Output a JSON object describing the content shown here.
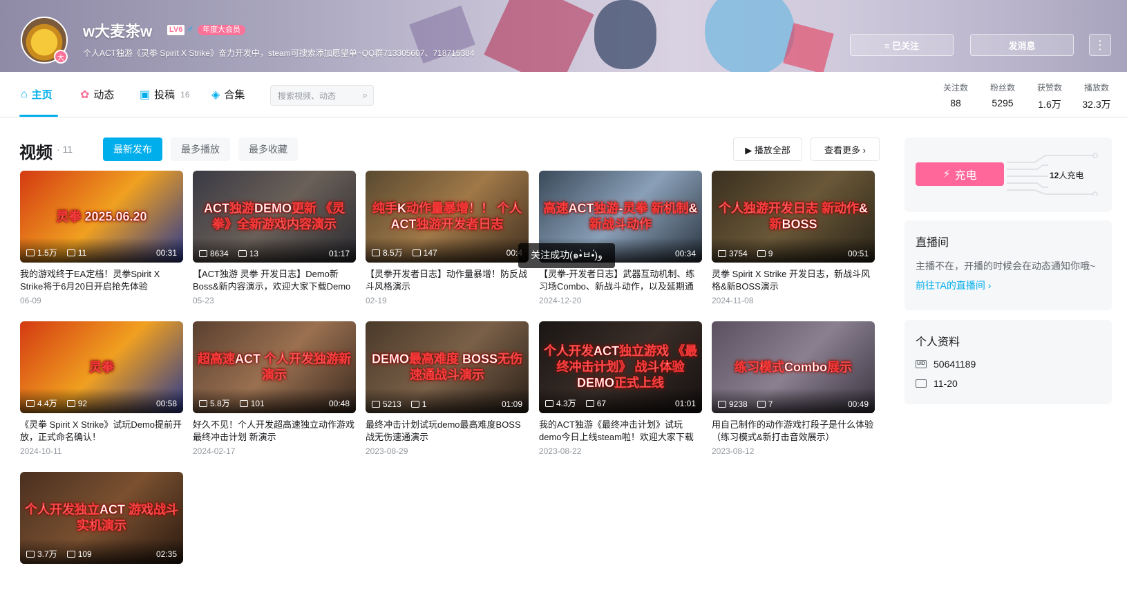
{
  "header": {
    "username": "w大麦茶w",
    "level": "LV6",
    "gender_symbol": "♂",
    "vip_badge": "年度大会员",
    "avatar_badge": "大",
    "signature": "个人ACT独游《灵拳 Spirit X Strike》奋力开发中，steam可搜索添加愿望单~QQ群713305607、718715384",
    "follow_button": "≡ 已关注",
    "message_button": "发消息",
    "more_button": "⋮"
  },
  "nav": {
    "items": [
      {
        "label": "主页",
        "icon": "home-icon"
      },
      {
        "label": "动态",
        "icon": "pinwheel-icon"
      },
      {
        "label": "投稿",
        "icon": "tv-icon",
        "count": "16"
      },
      {
        "label": "合集",
        "icon": "layers-icon"
      }
    ],
    "search_placeholder": "搜索视频、动态",
    "stats": [
      {
        "label": "关注数",
        "value": "88"
      },
      {
        "label": "粉丝数",
        "value": "5295"
      },
      {
        "label": "获赞数",
        "value": "1.6万"
      },
      {
        "label": "播放数",
        "value": "32.3万"
      }
    ]
  },
  "videos_section": {
    "title": "视频",
    "count": "· 11",
    "tabs": [
      "最新发布",
      "最多播放",
      "最多收藏"
    ],
    "play_all": "▶ 播放全部",
    "view_more": "查看更多 ›"
  },
  "videos": [
    {
      "thumb_text": "灵拳 2025.06.20",
      "views": "1.5万",
      "danmaku": "11",
      "duration": "00:31",
      "title": "我的游戏终于EA定档！灵拳Spirit X Strike将于6月20日开启抢先体验",
      "date": "06-09",
      "bg": "linear-gradient(135deg,#d43a12,#f0a020 50%,#2a3a90)"
    },
    {
      "thumb_text": "ACT独游DEMO更新 《灵拳》全新游戏内容演示",
      "views": "8634",
      "danmaku": "13",
      "duration": "01:17",
      "title": "【ACT独游 灵拳 开发日志】Demo新Boss&新内容演示，欢迎大家下载Demo体…",
      "date": "05-23",
      "bg": "linear-gradient(135deg,#3a3a44,#6a6058 50%,#2a2a30)"
    },
    {
      "thumb_text": "纯手K动作量暴增！！ 个人ACT独游开发者日志",
      "views": "8.5万",
      "danmaku": "147",
      "duration": "00:4",
      "title": "【灵拳开发者日志】动作量暴增！防反战斗风格演示",
      "date": "02-19",
      "bg": "linear-gradient(135deg,#5a4a30,#a07848 50%,#403020)"
    },
    {
      "thumb_text": "高速ACT独游-灵拳 新机制&新战斗动作",
      "views": "",
      "danmaku": "",
      "duration": "00:34",
      "title": "【灵拳-开发者日志】武器互动机制、练习场Combo、新战斗动作，以及延期通知",
      "date": "2024-12-20",
      "bg": "linear-gradient(135deg,#3a4a5a,#8aa0b8 50%,#2a3440)"
    },
    {
      "thumb_text": "个人独游开发日志 新动作&新BOSS",
      "views": "3754",
      "danmaku": "9",
      "duration": "00:51",
      "title": "灵拳 Spirit X Strike 开发日志，新战斗风格&新BOSS演示",
      "date": "2024-11-08",
      "bg": "linear-gradient(135deg,#3a3020,#6a5838 50%,#2a2418)"
    },
    {
      "thumb_text": "灵拳",
      "views": "4.4万",
      "danmaku": "92",
      "duration": "00:58",
      "title": "《灵拳 Spirit X Strike》试玩Demo提前开放，正式命名确认！",
      "date": "2024-10-11",
      "bg": "linear-gradient(135deg,#d43a12,#f0a020 50%,#2a3a90)"
    },
    {
      "thumb_text": "超高速ACT 个人开发独游新演示",
      "views": "5.8万",
      "danmaku": "101",
      "duration": "00:48",
      "title": "好久不见！个人开发超高速独立动作游戏最终冲击计划 新演示",
      "date": "2024-02-17",
      "bg": "linear-gradient(135deg,#5a4030,#9a7050 50%,#3a2a20)"
    },
    {
      "thumb_text": "DEMO最高难度 BOSS无伤速通战斗演示",
      "views": "5213",
      "danmaku": "1",
      "duration": "01:09",
      "title": "最终冲击计划试玩demo最高难度BOSS战无伤速通演示",
      "date": "2023-08-29",
      "bg": "linear-gradient(135deg,#4a3a2a,#7a6048 50%,#2a2018)"
    },
    {
      "thumb_text": "个人开发ACT独立游戏 《最终冲击计划》 战斗体验DEMO正式上线",
      "views": "4.3万",
      "danmaku": "67",
      "duration": "01:01",
      "title": "我的ACT独游《最终冲击计划》试玩demo今日上线steam啦！欢迎大家下载体验",
      "date": "2023-08-22",
      "bg": "linear-gradient(135deg,#1a1614,#3a2e28 50%,#141010)"
    },
    {
      "thumb_text": "练习模式Combo展示",
      "views": "9238",
      "danmaku": "7",
      "duration": "00:49",
      "title": "用自己制作的动作游戏打段子是什么体验（练习模式&新打击音效展示）",
      "date": "2023-08-12",
      "bg": "linear-gradient(135deg,#5a5060,#8a8090 50%,#3a3440)"
    },
    {
      "thumb_text": "个人开发独立ACT 游戏战斗实机演示",
      "views": "3.7万",
      "danmaku": "109",
      "duration": "02:35",
      "title": "",
      "date": "",
      "bg": "linear-gradient(135deg,#4a3020,#7a5030 50%,#2a1a10)"
    }
  ],
  "toast": "关注成功(๑•̀ㅂ•́)و",
  "sidebar": {
    "charge_button": "充电",
    "charge_count_num": "12",
    "charge_count_suffix": "人充电",
    "live_title": "直播间",
    "live_text": "主播不在，开播的时候会在动态通知你哦~",
    "live_link": "前往TA的直播间 ›",
    "profile_title": "个人资料",
    "uid": "50641189",
    "birthday": "11-20"
  },
  "colors": {
    "accent": "#00aeec",
    "pink": "#fb7299",
    "charge": "#ff6699"
  }
}
